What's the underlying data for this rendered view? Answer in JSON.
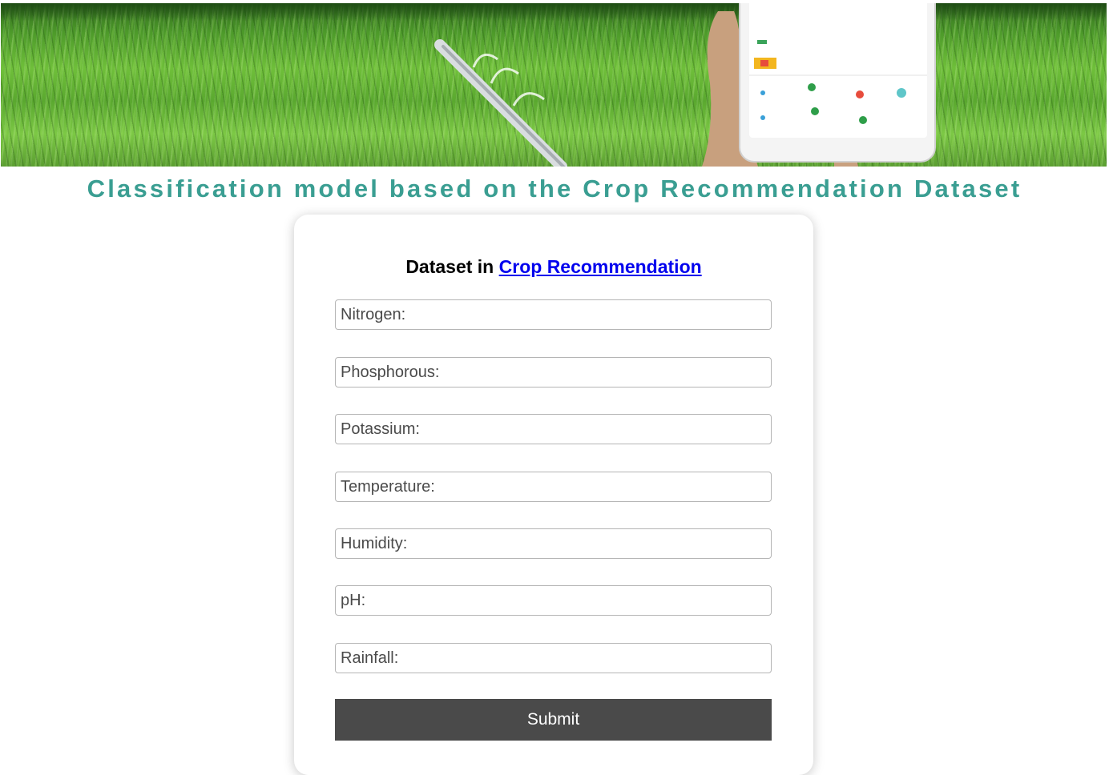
{
  "banner": {
    "image_name": "green-field-with-tablet-image"
  },
  "page": {
    "title": "Classification model based on the Crop Recommendation Dataset"
  },
  "form": {
    "heading_prefix": "Dataset in",
    "heading_link": "Crop Recommendation",
    "fields": [
      {
        "placeholder": "Nitrogen:",
        "value": ""
      },
      {
        "placeholder": "Phosphorous:",
        "value": ""
      },
      {
        "placeholder": "Potassium:",
        "value": ""
      },
      {
        "placeholder": "Temperature:",
        "value": ""
      },
      {
        "placeholder": "Humidity:",
        "value": ""
      },
      {
        "placeholder": "pH:",
        "value": ""
      },
      {
        "placeholder": "Rainfall:",
        "value": ""
      }
    ],
    "submit_label": "Submit"
  },
  "colors": {
    "title": "#3a9e92",
    "link": "#0000ee",
    "button_bg": "#4a4a4a",
    "button_text": "#ffffff"
  }
}
